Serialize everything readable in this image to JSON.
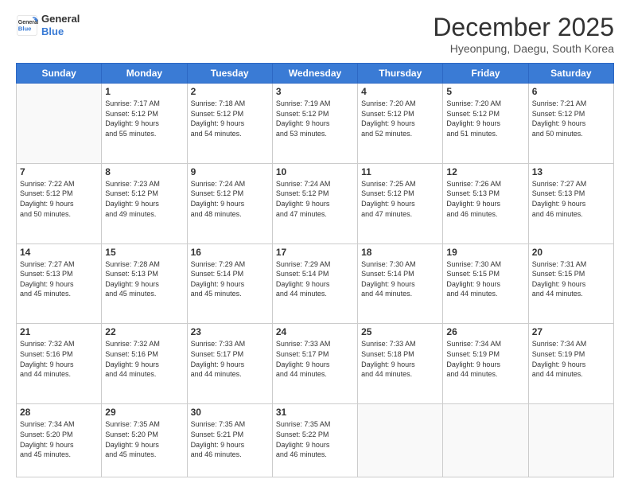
{
  "logo": {
    "general": "General",
    "blue": "Blue"
  },
  "header": {
    "month": "December 2025",
    "location": "Hyeonpung, Daegu, South Korea"
  },
  "weekdays": [
    "Sunday",
    "Monday",
    "Tuesday",
    "Wednesday",
    "Thursday",
    "Friday",
    "Saturday"
  ],
  "weeks": [
    [
      {
        "day": "",
        "info": ""
      },
      {
        "day": "1",
        "info": "Sunrise: 7:17 AM\nSunset: 5:12 PM\nDaylight: 9 hours\nand 55 minutes."
      },
      {
        "day": "2",
        "info": "Sunrise: 7:18 AM\nSunset: 5:12 PM\nDaylight: 9 hours\nand 54 minutes."
      },
      {
        "day": "3",
        "info": "Sunrise: 7:19 AM\nSunset: 5:12 PM\nDaylight: 9 hours\nand 53 minutes."
      },
      {
        "day": "4",
        "info": "Sunrise: 7:20 AM\nSunset: 5:12 PM\nDaylight: 9 hours\nand 52 minutes."
      },
      {
        "day": "5",
        "info": "Sunrise: 7:20 AM\nSunset: 5:12 PM\nDaylight: 9 hours\nand 51 minutes."
      },
      {
        "day": "6",
        "info": "Sunrise: 7:21 AM\nSunset: 5:12 PM\nDaylight: 9 hours\nand 50 minutes."
      }
    ],
    [
      {
        "day": "7",
        "info": "Sunrise: 7:22 AM\nSunset: 5:12 PM\nDaylight: 9 hours\nand 50 minutes."
      },
      {
        "day": "8",
        "info": "Sunrise: 7:23 AM\nSunset: 5:12 PM\nDaylight: 9 hours\nand 49 minutes."
      },
      {
        "day": "9",
        "info": "Sunrise: 7:24 AM\nSunset: 5:12 PM\nDaylight: 9 hours\nand 48 minutes."
      },
      {
        "day": "10",
        "info": "Sunrise: 7:24 AM\nSunset: 5:12 PM\nDaylight: 9 hours\nand 47 minutes."
      },
      {
        "day": "11",
        "info": "Sunrise: 7:25 AM\nSunset: 5:12 PM\nDaylight: 9 hours\nand 47 minutes."
      },
      {
        "day": "12",
        "info": "Sunrise: 7:26 AM\nSunset: 5:13 PM\nDaylight: 9 hours\nand 46 minutes."
      },
      {
        "day": "13",
        "info": "Sunrise: 7:27 AM\nSunset: 5:13 PM\nDaylight: 9 hours\nand 46 minutes."
      }
    ],
    [
      {
        "day": "14",
        "info": "Sunrise: 7:27 AM\nSunset: 5:13 PM\nDaylight: 9 hours\nand 45 minutes."
      },
      {
        "day": "15",
        "info": "Sunrise: 7:28 AM\nSunset: 5:13 PM\nDaylight: 9 hours\nand 45 minutes."
      },
      {
        "day": "16",
        "info": "Sunrise: 7:29 AM\nSunset: 5:14 PM\nDaylight: 9 hours\nand 45 minutes."
      },
      {
        "day": "17",
        "info": "Sunrise: 7:29 AM\nSunset: 5:14 PM\nDaylight: 9 hours\nand 44 minutes."
      },
      {
        "day": "18",
        "info": "Sunrise: 7:30 AM\nSunset: 5:14 PM\nDaylight: 9 hours\nand 44 minutes."
      },
      {
        "day": "19",
        "info": "Sunrise: 7:30 AM\nSunset: 5:15 PM\nDaylight: 9 hours\nand 44 minutes."
      },
      {
        "day": "20",
        "info": "Sunrise: 7:31 AM\nSunset: 5:15 PM\nDaylight: 9 hours\nand 44 minutes."
      }
    ],
    [
      {
        "day": "21",
        "info": "Sunrise: 7:32 AM\nSunset: 5:16 PM\nDaylight: 9 hours\nand 44 minutes."
      },
      {
        "day": "22",
        "info": "Sunrise: 7:32 AM\nSunset: 5:16 PM\nDaylight: 9 hours\nand 44 minutes."
      },
      {
        "day": "23",
        "info": "Sunrise: 7:33 AM\nSunset: 5:17 PM\nDaylight: 9 hours\nand 44 minutes."
      },
      {
        "day": "24",
        "info": "Sunrise: 7:33 AM\nSunset: 5:17 PM\nDaylight: 9 hours\nand 44 minutes."
      },
      {
        "day": "25",
        "info": "Sunrise: 7:33 AM\nSunset: 5:18 PM\nDaylight: 9 hours\nand 44 minutes."
      },
      {
        "day": "26",
        "info": "Sunrise: 7:34 AM\nSunset: 5:19 PM\nDaylight: 9 hours\nand 44 minutes."
      },
      {
        "day": "27",
        "info": "Sunrise: 7:34 AM\nSunset: 5:19 PM\nDaylight: 9 hours\nand 44 minutes."
      }
    ],
    [
      {
        "day": "28",
        "info": "Sunrise: 7:34 AM\nSunset: 5:20 PM\nDaylight: 9 hours\nand 45 minutes."
      },
      {
        "day": "29",
        "info": "Sunrise: 7:35 AM\nSunset: 5:20 PM\nDaylight: 9 hours\nand 45 minutes."
      },
      {
        "day": "30",
        "info": "Sunrise: 7:35 AM\nSunset: 5:21 PM\nDaylight: 9 hours\nand 46 minutes."
      },
      {
        "day": "31",
        "info": "Sunrise: 7:35 AM\nSunset: 5:22 PM\nDaylight: 9 hours\nand 46 minutes."
      },
      {
        "day": "",
        "info": ""
      },
      {
        "day": "",
        "info": ""
      },
      {
        "day": "",
        "info": ""
      }
    ]
  ]
}
